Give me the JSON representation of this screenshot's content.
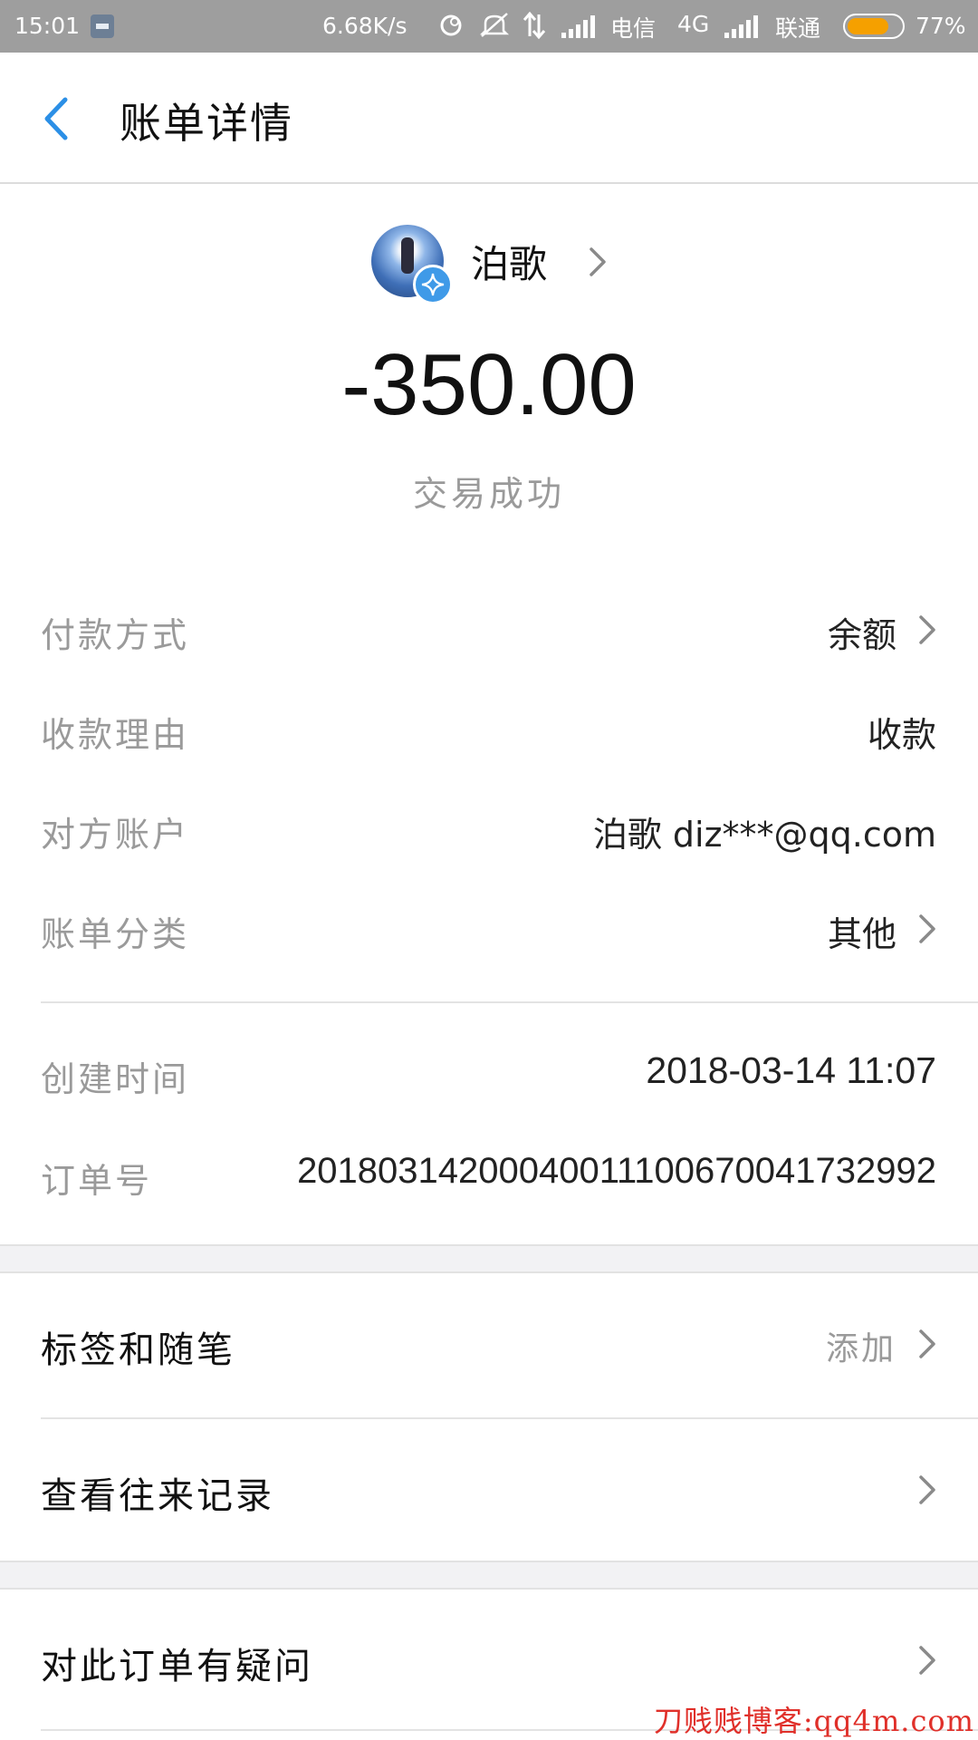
{
  "status_bar": {
    "time": "15:01",
    "net_speed": "6.68K/s",
    "carrier1": "电信",
    "network_type": "4G",
    "carrier2": "联通",
    "battery_text": "77%",
    "battery_level": 0.77,
    "battery_color": "#f5a000",
    "icons": [
      "notification-icon",
      "sync-icon",
      "mute-icon",
      "data-arrows-icon",
      "signal-icon",
      "signal-icon",
      "battery-icon"
    ]
  },
  "header": {
    "title": "账单详情",
    "accent_color": "#2b8fe6"
  },
  "summary": {
    "payee_name": "泊歌",
    "amount": "-350.00",
    "status": "交易成功"
  },
  "details": {
    "payment_method": {
      "label": "付款方式",
      "value": "余额"
    },
    "reason": {
      "label": "收款理由",
      "value": "收款"
    },
    "counterparty": {
      "label": "对方账户",
      "value": "泊歌 diz***@qq.com"
    },
    "category": {
      "label": "账单分类",
      "value": "其他"
    },
    "created_time": {
      "label": "创建时间",
      "value": "2018-03-14 11:07"
    },
    "order_no": {
      "label": "订单号",
      "value": "20180314200040011100670041732992"
    }
  },
  "actions": {
    "tags_notes": {
      "label": "标签和随笔",
      "value": "添加"
    },
    "history": {
      "label": "查看往来记录"
    },
    "question": {
      "label": "对此订单有疑问"
    }
  },
  "watermark": "刀贱贱博客:qq4m.com"
}
